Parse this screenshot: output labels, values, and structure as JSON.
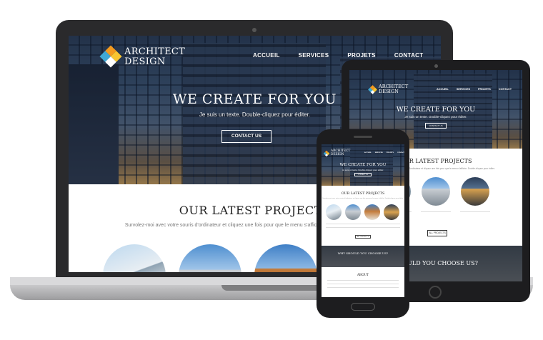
{
  "brand": {
    "line1": "ARCHITECT",
    "line2": "DESIGN"
  },
  "colors": {
    "logo_orange": "#f39a1e",
    "logo_blue": "#3fa9d6",
    "logo_yellow": "#f7c531",
    "hero_overlay": "#2b3e57"
  },
  "nav": {
    "items": [
      "ACCUEIL",
      "SERVICES",
      "PROJETS",
      "CONTACT"
    ]
  },
  "hero": {
    "headline": "WE CREATE FOR YOU",
    "subtitle": "Je suis un texte. Double-cliquez pour éditer.",
    "cta_label": "CONTACT US"
  },
  "projects": {
    "title": "OUR LATEST PROJECTS",
    "description": "Survolez-moi avec votre souris d'ordinateur et cliquez une fois pour que le menu s'affiche. Double-cliquez pour éditer."
  },
  "tablet": {
    "all_projects_label": "ALL PROJECTS",
    "why_title": "SHOULD YOU CHOOSE US?"
  },
  "phone": {
    "why_title": "WHY SHOULD YOU CHOOSE US?",
    "about_title": "ABOUT",
    "all_projects_label": "ALL PROJECTS"
  }
}
